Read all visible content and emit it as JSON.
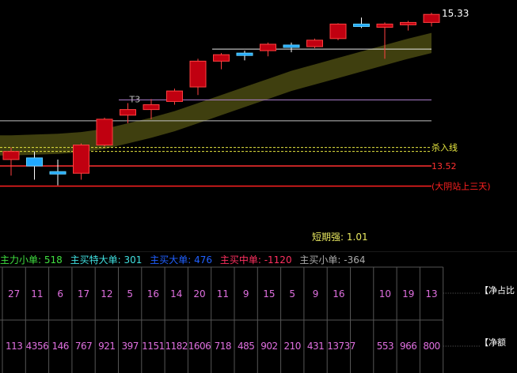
{
  "chart_data": {
    "type": "candlestick",
    "candles": [
      {
        "o": 13.7,
        "c": 13.6,
        "h": 13.75,
        "l": 13.4,
        "color": "red"
      },
      {
        "o": 13.62,
        "c": 13.52,
        "h": 13.7,
        "l": 13.35,
        "color": "cyan"
      },
      {
        "o": 13.45,
        "c": 13.42,
        "h": 13.6,
        "l": 13.28,
        "color": "cyan"
      },
      {
        "o": 13.43,
        "c": 13.78,
        "h": 13.8,
        "l": 13.35,
        "color": "red"
      },
      {
        "o": 13.78,
        "c": 14.1,
        "h": 14.12,
        "l": 13.76,
        "color": "red"
      },
      {
        "o": 14.15,
        "c": 14.22,
        "h": 14.3,
        "l": 14.05,
        "color": "red"
      },
      {
        "o": 14.22,
        "c": 14.28,
        "h": 14.35,
        "l": 14.1,
        "color": "red"
      },
      {
        "o": 14.32,
        "c": 14.45,
        "h": 14.48,
        "l": 14.28,
        "color": "red"
      },
      {
        "o": 14.5,
        "c": 14.82,
        "h": 14.85,
        "l": 14.4,
        "color": "red"
      },
      {
        "o": 14.82,
        "c": 14.9,
        "h": 14.92,
        "l": 14.72,
        "color": "red"
      },
      {
        "o": 14.92,
        "c": 14.9,
        "h": 14.95,
        "l": 14.83,
        "color": "cyan"
      },
      {
        "o": 14.95,
        "c": 15.03,
        "h": 15.05,
        "l": 14.88,
        "color": "red"
      },
      {
        "o": 15.02,
        "c": 15.0,
        "h": 15.05,
        "l": 14.93,
        "color": "cyan"
      },
      {
        "o": 15.0,
        "c": 15.08,
        "h": 15.1,
        "l": 14.98,
        "color": "red"
      },
      {
        "o": 15.1,
        "c": 15.28,
        "h": 15.29,
        "l": 15.08,
        "color": "red"
      },
      {
        "o": 15.28,
        "c": 15.25,
        "h": 15.36,
        "l": 15.23,
        "color": "cyan"
      },
      {
        "o": 15.24,
        "c": 15.28,
        "h": 15.3,
        "l": 14.85,
        "color": "red"
      },
      {
        "o": 15.28,
        "c": 15.3,
        "h": 15.32,
        "l": 15.2,
        "color": "red"
      },
      {
        "o": 15.3,
        "c": 15.4,
        "h": 15.42,
        "l": 15.25,
        "color": "red"
      }
    ],
    "ylim": [
      13.05,
      15.5
    ],
    "hlines": [
      {
        "price": 14.97,
        "color": "#e8e8e8",
        "label": ""
      },
      {
        "price": 14.34,
        "color": "#b080d0",
        "label": ""
      },
      {
        "price": 14.08,
        "color": "#c0c0c0",
        "label": ""
      },
      {
        "price": 13.75,
        "color": "#e8e840",
        "label": "杀入线",
        "dashed": true
      },
      {
        "price": 13.52,
        "color": "#ff3030",
        "label": "13.52"
      },
      {
        "price": 13.27,
        "color": "#ff2020",
        "label": "(大阴站上三天)"
      }
    ],
    "band_upper": [
      13.9,
      13.91,
      13.92,
      13.94,
      13.98,
      14.05,
      14.12,
      14.2,
      14.3,
      14.4,
      14.5,
      14.6,
      14.7,
      14.78,
      14.86,
      14.94,
      15.02,
      15.1,
      15.17
    ],
    "band_lower": [
      13.65,
      13.66,
      13.67,
      13.69,
      13.73,
      13.8,
      13.87,
      13.95,
      14.05,
      14.15,
      14.25,
      14.35,
      14.45,
      14.53,
      14.61,
      14.69,
      14.77,
      14.85,
      14.92
    ],
    "annotation_t3": "T3",
    "last_price": "15.33",
    "short_strength_label": "短期强:",
    "short_strength_value": "1.01"
  },
  "indicators": [
    {
      "label": "主力小单:",
      "value": "518",
      "color": "#40e040"
    },
    {
      "label": "主买特大单:",
      "value": "301",
      "color": "#40e0e0"
    },
    {
      "label": "主买大单:",
      "value": "476",
      "color": "#2060ff"
    },
    {
      "label": "主买中单:",
      "value": "-1120",
      "color": "#ff3060"
    },
    {
      "label": "主买小单:",
      "value": "-364",
      "color": "#aaaaaa"
    }
  ],
  "table": {
    "ratio_label": "【净占比",
    "amount_label": "【净额",
    "ratios": [
      "27",
      "11",
      "6",
      "17",
      "12",
      "5",
      "16",
      "14",
      "20",
      "11",
      "9",
      "15",
      "5",
      "9",
      "16",
      "",
      "10",
      "19",
      "13"
    ],
    "amounts": [
      "113",
      "4356",
      "146",
      "767",
      "921",
      "397",
      "1151",
      "1182",
      "1606",
      "718",
      "485",
      "902",
      "210",
      "431",
      "13737",
      "",
      "553",
      "966",
      "800"
    ]
  }
}
